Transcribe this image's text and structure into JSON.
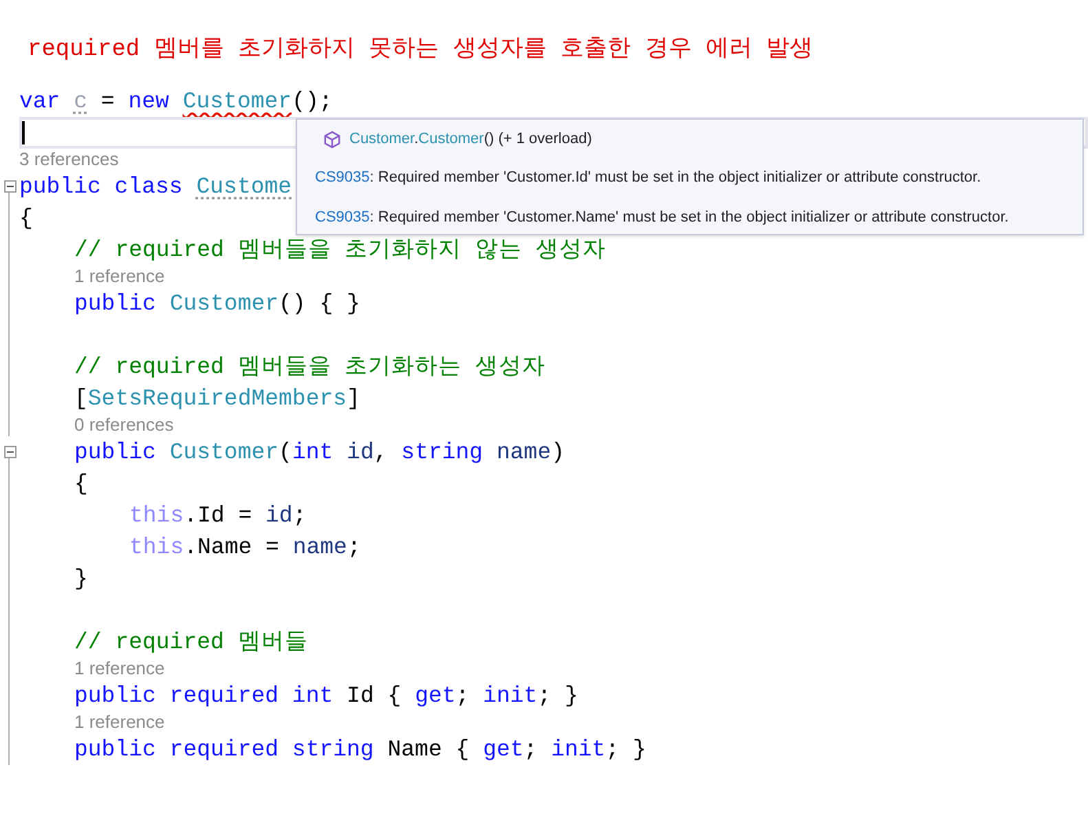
{
  "title": "required 멤버를 초기화하지 못하는 생성자를 호출한 경우 에러 발생",
  "editor": {
    "lines": [
      {
        "kind": "code",
        "tokens": [
          {
            "kind": "keyword",
            "text": "var "
          },
          {
            "kind": "faded",
            "text": "c",
            "hint": true
          },
          {
            "kind": "plain",
            "text": " = "
          },
          {
            "kind": "keyword",
            "text": "new "
          },
          {
            "kind": "type",
            "text": "Customer",
            "error": true
          },
          {
            "kind": "plain",
            "text": "();"
          }
        ]
      },
      {
        "kind": "current"
      },
      {
        "kind": "lens",
        "text": "3 references"
      },
      {
        "kind": "code",
        "expanded": true,
        "tokens": [
          {
            "kind": "keyword",
            "text": "public class "
          },
          {
            "kind": "type",
            "text": "Custome",
            "hint": true
          }
        ]
      },
      {
        "kind": "code",
        "tokens": [
          {
            "kind": "plain",
            "text": "{"
          }
        ]
      },
      {
        "kind": "block",
        "children": [
          {
            "kind": "code",
            "tokens": [
              {
                "kind": "comment",
                "text": "// required 멤버들을 초기화하지 않는 생성자"
              }
            ]
          },
          {
            "kind": "lens",
            "text": "1 reference"
          },
          {
            "kind": "code",
            "tokens": [
              {
                "kind": "keyword",
                "text": "public "
              },
              {
                "kind": "type",
                "text": "Customer"
              },
              {
                "kind": "plain",
                "text": "() { }"
              }
            ]
          },
          {
            "kind": "blank"
          },
          {
            "kind": "code",
            "tokens": [
              {
                "kind": "comment",
                "text": "// required 멤버들을 초기화하는 생성자"
              }
            ]
          },
          {
            "kind": "code",
            "tokens": [
              {
                "kind": "plain",
                "text": "["
              },
              {
                "kind": "type",
                "text": "SetsRequiredMembers"
              },
              {
                "kind": "plain",
                "text": "]"
              }
            ]
          },
          {
            "kind": "lens",
            "text": "0 references"
          },
          {
            "kind": "code",
            "expanded": true,
            "tokens": [
              {
                "kind": "keyword",
                "text": "public "
              },
              {
                "kind": "type",
                "text": "Customer"
              },
              {
                "kind": "plain",
                "text": "("
              },
              {
                "kind": "keyword",
                "text": "int "
              },
              {
                "kind": "param",
                "text": "id"
              },
              {
                "kind": "plain",
                "text": ", "
              },
              {
                "kind": "keyword",
                "text": "string "
              },
              {
                "kind": "param",
                "text": "name"
              },
              {
                "kind": "plain",
                "text": ")"
              }
            ]
          },
          {
            "kind": "code",
            "tokens": [
              {
                "kind": "plain",
                "text": "{"
              }
            ]
          },
          {
            "kind": "block",
            "children": [
              {
                "kind": "code",
                "tokens": [
                  {
                    "kind": "this",
                    "text": "this"
                  },
                  {
                    "kind": "plain",
                    "text": ".Id = "
                  },
                  {
                    "kind": "param",
                    "text": "id"
                  },
                  {
                    "kind": "plain",
                    "text": ";"
                  }
                ]
              },
              {
                "kind": "code",
                "tokens": [
                  {
                    "kind": "this",
                    "text": "this"
                  },
                  {
                    "kind": "plain",
                    "text": ".Name = "
                  },
                  {
                    "kind": "param",
                    "text": "name"
                  },
                  {
                    "kind": "plain",
                    "text": ";"
                  }
                ]
              }
            ]
          },
          {
            "kind": "code",
            "tokens": [
              {
                "kind": "plain",
                "text": "}"
              }
            ]
          },
          {
            "kind": "blank"
          },
          {
            "kind": "code",
            "tokens": [
              {
                "kind": "comment",
                "text": "// required 멤버들"
              }
            ]
          },
          {
            "kind": "lens",
            "text": "1 reference"
          },
          {
            "kind": "code",
            "tokens": [
              {
                "kind": "keyword",
                "text": "public required int "
              },
              {
                "kind": "plain",
                "text": "Id { "
              },
              {
                "kind": "keyword",
                "text": "get"
              },
              {
                "kind": "plain",
                "text": "; "
              },
              {
                "kind": "keyword",
                "text": "init"
              },
              {
                "kind": "plain",
                "text": "; }"
              }
            ]
          },
          {
            "kind": "lens",
            "text": "1 reference"
          },
          {
            "kind": "code",
            "tokens": [
              {
                "kind": "keyword",
                "text": "public required string "
              },
              {
                "kind": "plain",
                "text": "Name { "
              },
              {
                "kind": "keyword",
                "text": "get"
              },
              {
                "kind": "plain",
                "text": "; "
              },
              {
                "kind": "keyword",
                "text": "init"
              },
              {
                "kind": "plain",
                "text": "; }"
              }
            ]
          }
        ]
      }
    ]
  },
  "tooltip": {
    "signature": [
      {
        "kind": "type",
        "text": "Customer"
      },
      {
        "kind": "plain",
        "text": "."
      },
      {
        "kind": "type",
        "text": "Customer"
      },
      {
        "kind": "plain",
        "text": "() (+ 1 overload)"
      }
    ],
    "errors": [
      {
        "code": "CS9035",
        "message": ": Required member 'Customer.Id' must be set in the object initializer or attribute constructor."
      },
      {
        "code": "CS9035",
        "message": ": Required member 'Customer.Name' must be set in the object initializer or attribute constructor."
      }
    ]
  }
}
